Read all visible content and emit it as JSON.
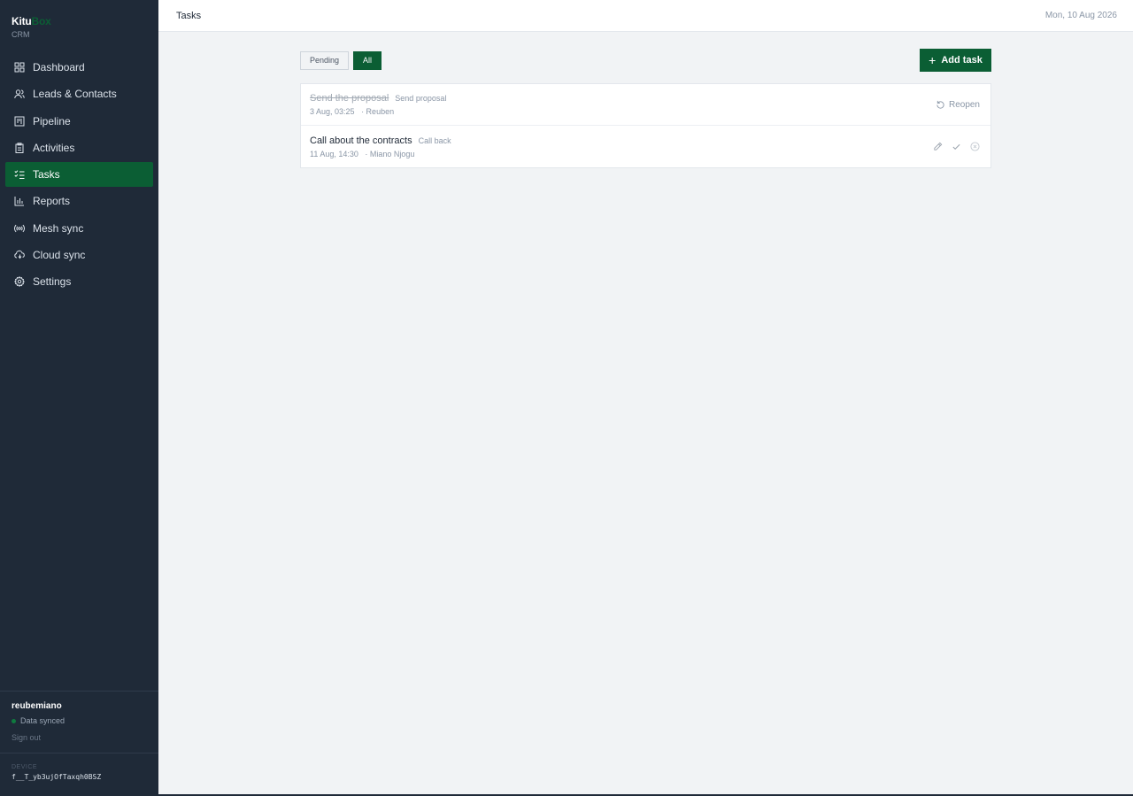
{
  "brand": {
    "name_part1": "Kitu",
    "name_part2": "Box",
    "subtitle": "CRM"
  },
  "sidebar": {
    "items": [
      {
        "label": "Dashboard",
        "icon": "grid-icon"
      },
      {
        "label": "Leads & Contacts",
        "icon": "users-icon"
      },
      {
        "label": "Pipeline",
        "icon": "kanban-icon"
      },
      {
        "label": "Activities",
        "icon": "clipboard-icon"
      },
      {
        "label": "Tasks",
        "icon": "checklist-icon",
        "active": true
      },
      {
        "label": "Reports",
        "icon": "bar-chart-icon"
      },
      {
        "label": "Mesh sync",
        "icon": "radio-icon"
      },
      {
        "label": "Cloud sync",
        "icon": "cloud-sync-icon"
      },
      {
        "label": "Settings",
        "icon": "gear-icon"
      }
    ],
    "user": {
      "name": "reubemiano",
      "status": "Data synced",
      "sign_out": "Sign out"
    },
    "device": {
      "label": "DEVICE",
      "id": "f__T_yb3ujOfTaxqh0BSZ"
    }
  },
  "topbar": {
    "title": "Tasks",
    "date": "Mon, 10 Aug 2026"
  },
  "toolbar": {
    "filters": [
      {
        "label": "Pending",
        "active": false
      },
      {
        "label": "All",
        "active": true
      }
    ],
    "add_label": "Add task"
  },
  "tasks": [
    {
      "title": "Send the proposal",
      "type": "Send proposal",
      "when": "3 Aug, 03:25",
      "who": "· Reuben",
      "done": true,
      "reopen_label": "Reopen"
    },
    {
      "title": "Call about the contracts",
      "type": "Call back",
      "when": "11 Aug, 14:30",
      "who": "· Miano Njogu",
      "done": false
    }
  ],
  "colors": {
    "sidebar_bg": "#1f2a38",
    "accent": "#0b5e34",
    "page_bg": "#f1f3f5"
  }
}
